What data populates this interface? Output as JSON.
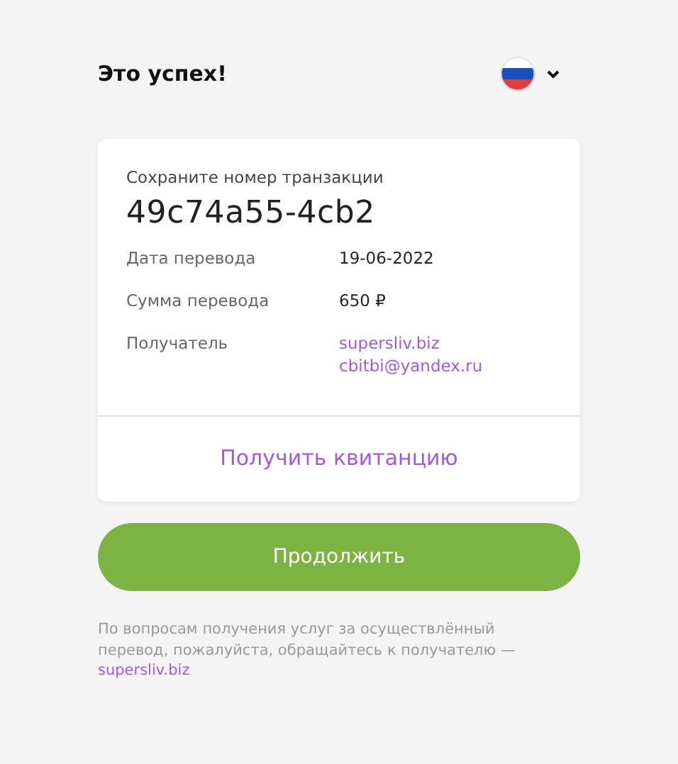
{
  "header": {
    "title": "Это успех!"
  },
  "card": {
    "caption": "Сохраните номер транзакции",
    "transaction_id": "49c74a55-4cb2",
    "rows": [
      {
        "label": "Дата перевода",
        "values": [
          {
            "kind": "text",
            "text": "19-06-2022"
          }
        ]
      },
      {
        "label": "Сумма перевода",
        "values": [
          {
            "kind": "text",
            "text": "650 ₽"
          }
        ]
      },
      {
        "label": "Получатель",
        "values": [
          {
            "kind": "link",
            "text": "supersliv.biz"
          },
          {
            "kind": "link",
            "text": "cbitbi@yandex.ru"
          }
        ]
      }
    ],
    "receipt_link": "Получить квитанцию"
  },
  "continue_button": "Продолжить",
  "footnote": {
    "text": "По вопросам получения услуг за осуществлённый перевод, пожалуйста, обращайтесь к получателю —",
    "link": "supersliv.biz"
  }
}
